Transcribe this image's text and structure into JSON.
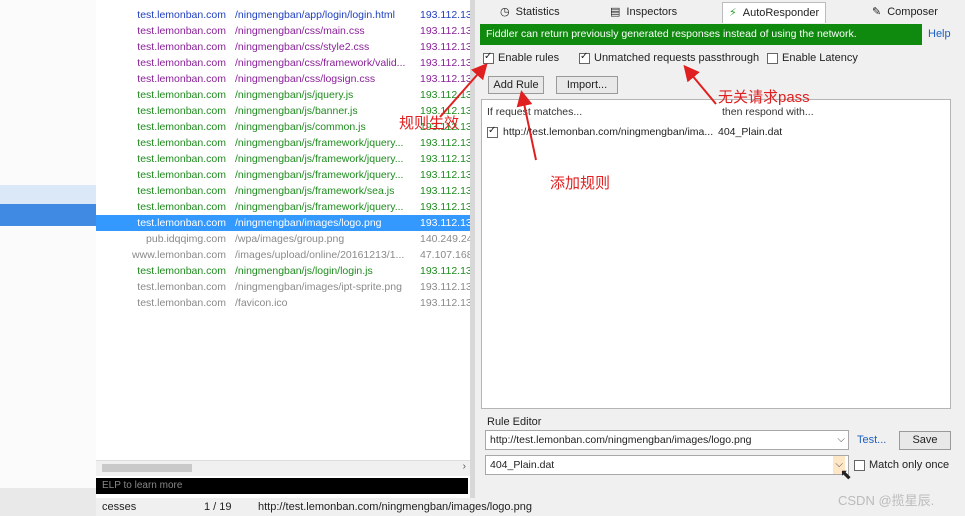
{
  "sessions": [
    {
      "host": "test.lemonban.com",
      "url": "/ningmengban/app/login/login.html",
      "ip": "193.112.13",
      "color": "#1f3fbf"
    },
    {
      "host": "test.lemonban.com",
      "url": "/ningmengban/css/main.css",
      "ip": "193.112.13",
      "color": "#8b1f9a"
    },
    {
      "host": "test.lemonban.com",
      "url": "/ningmengban/css/style2.css",
      "ip": "193.112.13",
      "color": "#8b1f9a"
    },
    {
      "host": "test.lemonban.com",
      "url": "/ningmengban/css/framework/valid...",
      "ip": "193.112.13",
      "color": "#8b1f9a"
    },
    {
      "host": "test.lemonban.com",
      "url": "/ningmengban/css/logsign.css",
      "ip": "193.112.13",
      "color": "#8b1f9a"
    },
    {
      "host": "test.lemonban.com",
      "url": "/ningmengban/js/jquery.js",
      "ip": "193.112.13",
      "color": "#1e8c1e"
    },
    {
      "host": "test.lemonban.com",
      "url": "/ningmengban/js/banner.js",
      "ip": "193.112.13",
      "color": "#1e8c1e"
    },
    {
      "host": "test.lemonban.com",
      "url": "/ningmengban/js/common.js",
      "ip": "193.112.13",
      "color": "#1e8c1e"
    },
    {
      "host": "test.lemonban.com",
      "url": "/ningmengban/js/framework/jquery...",
      "ip": "193.112.13",
      "color": "#1e8c1e"
    },
    {
      "host": "test.lemonban.com",
      "url": "/ningmengban/js/framework/jquery...",
      "ip": "193.112.13",
      "color": "#1e8c1e"
    },
    {
      "host": "test.lemonban.com",
      "url": "/ningmengban/js/framework/jquery...",
      "ip": "193.112.13",
      "color": "#1e8c1e"
    },
    {
      "host": "test.lemonban.com",
      "url": "/ningmengban/js/framework/sea.js",
      "ip": "193.112.13",
      "color": "#1e8c1e"
    },
    {
      "host": "test.lemonban.com",
      "url": "/ningmengban/js/framework/jquery...",
      "ip": "193.112.13",
      "color": "#1e8c1e"
    },
    {
      "host": "test.lemonban.com",
      "url": "/ningmengban/images/logo.png",
      "ip": "193.112.13",
      "color": "#ffffff",
      "selected": true
    },
    {
      "host": "pub.idqqimg.com",
      "url": "/wpa/images/group.png",
      "ip": "140.249.24",
      "color": "#8a8a8a"
    },
    {
      "host": "www.lemonban.com",
      "url": "/images/upload/online/20161213/1...",
      "ip": "47.107.168",
      "color": "#8a8a8a"
    },
    {
      "host": "test.lemonban.com",
      "url": "/ningmengban/js/login/login.js",
      "ip": "193.112.13",
      "color": "#1e8c1e"
    },
    {
      "host": "test.lemonban.com",
      "url": "/ningmengban/images/ipt-sprite.png",
      "ip": "193.112.13",
      "color": "#8a8a8a"
    },
    {
      "host": "test.lemonban.com",
      "url": "/favicon.ico",
      "ip": "193.112.13",
      "color": "#8a8a8a"
    }
  ],
  "quickexec": {
    "text": "ELP to learn more"
  },
  "status": {
    "processes": "cesses",
    "count": "1 / 19",
    "url": "http://test.lemonban.com/ningmengban/images/logo.png"
  },
  "tabs": {
    "statistics": "Statistics",
    "inspectors": "Inspectors",
    "autoresponder": "AutoResponder",
    "composer": "Composer"
  },
  "banner": {
    "text": "Fiddler can return previously generated responses instead of using the network.",
    "help": "Help",
    "color": "#0f8a0f"
  },
  "options": {
    "enable_rules": "Enable rules",
    "unmatched": "Unmatched requests passthrough",
    "latency": "Enable Latency"
  },
  "buttons": {
    "add_rule": "Add Rule",
    "import": "Import..."
  },
  "rules": {
    "header_match": "If request matches...",
    "header_respond": "then respond with...",
    "items": [
      {
        "match": "http://test.lemonban.com/ningmengban/ima...",
        "respond": "404_Plain.dat"
      }
    ]
  },
  "editor": {
    "label": "Rule Editor",
    "match_value": "http://test.lemonban.com/ningmengban/images/logo.png",
    "respond_value": "404_Plain.dat",
    "test": "Test...",
    "save": "Save",
    "match_once": "Match only once"
  },
  "annotations": {
    "rules_take_effect": "规则生效",
    "add_rule": "添加规则",
    "unrelated_pass": "无关请求pass",
    "color": "#e02020"
  },
  "watermark": "CSDN @揽星辰."
}
